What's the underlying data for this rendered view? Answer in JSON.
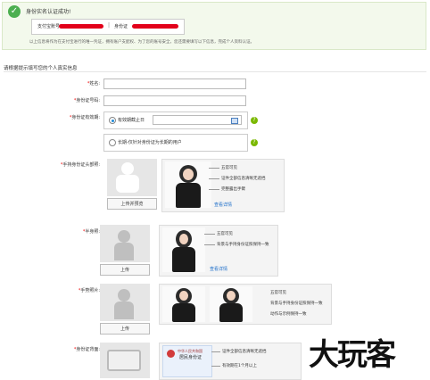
{
  "banner": {
    "title": "身份实名认证成功!",
    "account_label": "支付宝账号",
    "separator": "|",
    "id_label": "身份证",
    "note": "以上信息将作为在支付宝进行的唯一凭证，拥有账户支配权、为了您的账号安全，您还需要填写以下信息，完成个人资料认证。"
  },
  "form": {
    "section_title": "请根据提示填写您的个人真实信息",
    "name_label": "姓名:",
    "id_label": "身份证号码:",
    "validity_label": "身份证有效期:",
    "option_until": "有效期截止日",
    "option_longterm": "长期-仅针对身份证为长期的用户",
    "required_mark": "*"
  },
  "uploads": {
    "handheld": {
      "label": "手持身份证头部照:",
      "button": "上传并预览",
      "tips": [
        "五官可见",
        "证件全部信息清晰无遮挡",
        "完整露出手臂"
      ],
      "link": "查看详情"
    },
    "half_body": {
      "label": "半身照:",
      "button": "上传",
      "tips": [
        "五官可见",
        "背景与手持身份证照保持一致"
      ],
      "link": "查看详情"
    },
    "gesture": {
      "label": "手势照片:",
      "button": "上传",
      "tips": [
        "五官可见",
        "背景与手持身份证照保持一致",
        "动作与示例保持一致"
      ]
    },
    "id_back": {
      "label": "身份证背面:",
      "card_title": "中华人民共和国",
      "card_subtitle": "居民身份证",
      "tips": [
        "证件全部信息清晰无遮挡",
        "有效期在1个月以上"
      ]
    }
  },
  "watermark": "大玩客",
  "colors": {
    "success": "#4caf50",
    "link": "#1c6dc9",
    "required": "#e00000",
    "help": "#7ab800"
  }
}
